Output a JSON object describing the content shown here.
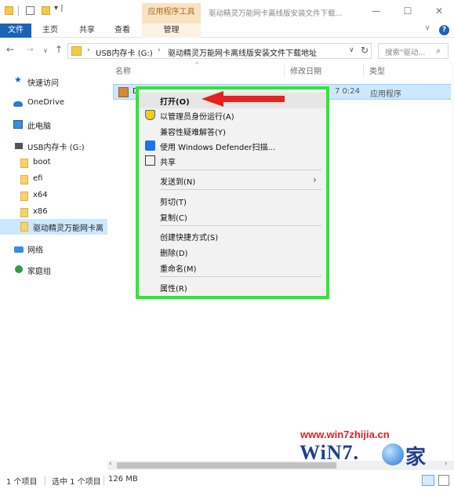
{
  "titlebar": {
    "quick_access_menu": "▾ |",
    "context_tab_header": "应用程序工具",
    "window_title": "驱动精灵万能网卡离线版安装文件下载...",
    "min": "—",
    "max": "☐",
    "close": "✕"
  },
  "ribbon": {
    "tab_file": "文件",
    "tab_home": "主页",
    "tab_share": "共享",
    "tab_view": "查看",
    "tab_manage": "管理",
    "chevron": "∨",
    "help": "?"
  },
  "nav": {
    "back": "←",
    "forward": "→",
    "recent": "∨",
    "up": "↑",
    "sep": "›",
    "drive": "USB内存卡 (G:)",
    "path": "驱动精灵万能网卡离线版安装文件下载地址",
    "dropdown": "∨",
    "refresh": "↻",
    "search_placeholder": "搜索\"驱动...",
    "search_glyph": "⌕"
  },
  "sidebar": {
    "items": [
      {
        "label": "快速访问"
      },
      {
        "label": "OneDrive"
      },
      {
        "label": "此电脑"
      },
      {
        "label": "USB内存卡 (G:)"
      },
      {
        "label": "boot"
      },
      {
        "label": "efi"
      },
      {
        "label": "x64"
      },
      {
        "label": "x86"
      },
      {
        "label": "驱动精灵万能网卡离"
      },
      {
        "label": "网络"
      },
      {
        "label": "家庭组"
      }
    ]
  },
  "columns": {
    "name": "名称",
    "date": "修改日期",
    "type": "类型",
    "sort_caret": "^"
  },
  "file": {
    "name": "D",
    "date": "7 0:24",
    "type": "应用程序"
  },
  "context_menu": {
    "open": "打开(O)",
    "run_as_admin": "以管理员身份运行(A)",
    "troubleshoot": "兼容性疑难解答(Y)",
    "defender": "使用 Windows Defender扫描...",
    "share": "共享",
    "send_to": "发送到(N)",
    "send_to_arrow": "›",
    "cut": "剪切(T)",
    "copy": "复制(C)",
    "create_shortcut": "创建快捷方式(S)",
    "delete": "删除(D)",
    "rename": "重命名(M)",
    "properties": "属性(R)"
  },
  "statusbar": {
    "count": "1 个项目",
    "selected": "选中 1 个项目",
    "size": "126 MB"
  },
  "scroll": {
    "left": "‹",
    "right": "›"
  },
  "watermark": {
    "url": "www.win7zhijia.cn",
    "logo_text": "WiN7.",
    "logo_char": "家"
  },
  "colors": {
    "highlight_border": "#2ee832",
    "annotation_arrow": "#e8201e",
    "selection": "#cce8ff",
    "accent": "#1a63b6"
  }
}
